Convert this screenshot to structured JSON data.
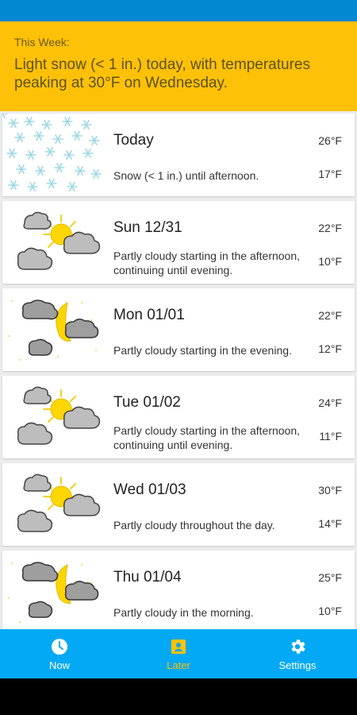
{
  "summary": {
    "label": "This Week:",
    "text": "Light snow (< 1 in.) today, with temperatures peaking at 30°F on Wednesday."
  },
  "forecast": [
    {
      "day": "Today",
      "desc": "Snow (< 1 in.) until afternoon.",
      "high": "26°F",
      "low": "17°F",
      "icon": "snow-icon"
    },
    {
      "day": "Sun 12/31",
      "desc": "Partly cloudy starting in the afternoon, continuing until evening.",
      "high": "22°F",
      "low": "10°F",
      "icon": "partly-cloudy-day-icon"
    },
    {
      "day": "Mon 01/01",
      "desc": "Partly cloudy starting in the evening.",
      "high": "22°F",
      "low": "12°F",
      "icon": "partly-cloudy-night-icon"
    },
    {
      "day": "Tue 01/02",
      "desc": "Partly cloudy starting in the afternoon, continuing until evening.",
      "high": "24°F",
      "low": "11°F",
      "icon": "partly-cloudy-day-icon"
    },
    {
      "day": "Wed 01/03",
      "desc": "Partly cloudy throughout the day.",
      "high": "30°F",
      "low": "14°F",
      "icon": "partly-cloudy-day-icon"
    },
    {
      "day": "Thu 01/04",
      "desc": "Partly cloudy in the morning.",
      "high": "25°F",
      "low": "10°F",
      "icon": "partly-cloudy-night-icon"
    }
  ],
  "nav": {
    "now": "Now",
    "later": "Later",
    "settings": "Settings",
    "active": "later"
  },
  "colors": {
    "status_bar": "#0288d1",
    "summary_bg": "#ffc107",
    "nav_bg": "#03a9f4",
    "nav_active": "#ffc107"
  }
}
